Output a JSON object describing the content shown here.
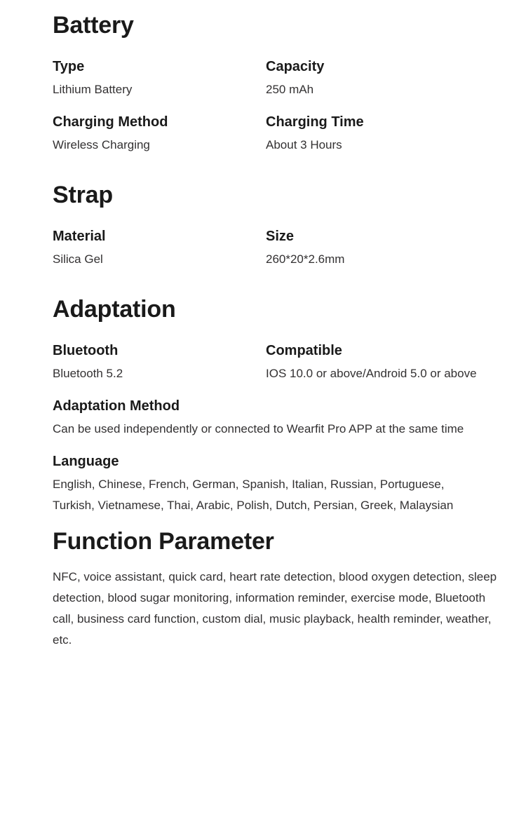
{
  "sections": [
    {
      "id": "battery",
      "title": "Battery",
      "rows": [
        {
          "left": {
            "label": "Type",
            "value": "Lithium Battery"
          },
          "right": {
            "label": "Capacity",
            "value": "250 mAh"
          }
        },
        {
          "left": {
            "label": "Charging Method",
            "value": "Wireless Charging"
          },
          "right": {
            "label": "Charging Time",
            "value": "About 3 Hours"
          }
        }
      ]
    },
    {
      "id": "strap",
      "title": "Strap",
      "rows": [
        {
          "left": {
            "label": "Material",
            "value": "Silica Gel"
          },
          "right": {
            "label": "Size",
            "value": "260*20*2.6mm"
          }
        }
      ]
    },
    {
      "id": "adaptation",
      "title": "Adaptation",
      "rows": [
        {
          "left": {
            "label": "Bluetooth",
            "value": "Bluetooth 5.2"
          },
          "right": {
            "label": "Compatible",
            "value": "IOS 10.0 or above/Android 5.0 or above"
          }
        }
      ],
      "blocks": [
        {
          "id": "adaptation-method",
          "label": "Adaptation Method",
          "value": "Can be used independently or connected to Wearfit Pro APP at the same time"
        },
        {
          "id": "language",
          "label": "Language",
          "value": "English, Chinese, French, German, Spanish, Italian, Russian, Portuguese, Turkish, Vietnamese, Thai, Arabic, Polish, Dutch, Persian, Greek, Malaysian"
        }
      ]
    },
    {
      "id": "function-parameter",
      "title": "Function Parameter",
      "paragraph": "NFC, voice assistant, quick card, heart rate detection, blood oxygen detection, sleep detection, blood sugar monitoring, information reminder, exercise mode, Bluetooth call, business card function, custom dial, music playback, health reminder, weather, etc."
    }
  ],
  "colors": {
    "background": "#ffffff",
    "heading": "#1a1a1a",
    "body": "#333132"
  }
}
